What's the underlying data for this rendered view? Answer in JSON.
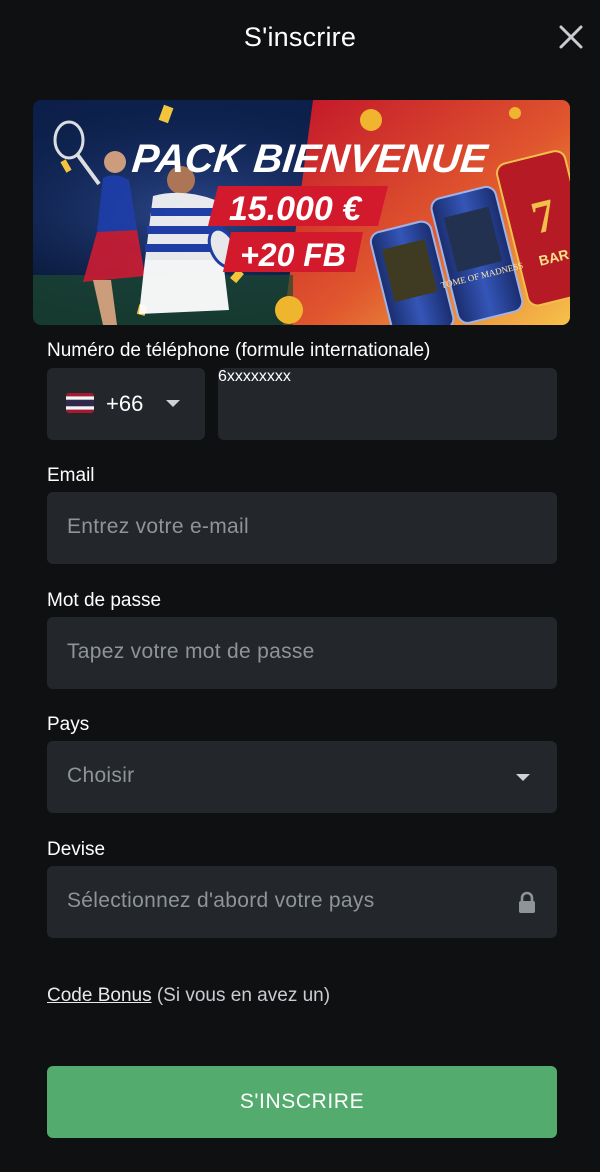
{
  "header": {
    "title": "S'inscrire"
  },
  "banner": {
    "headline": "PACK BIENVENUE",
    "amount": "15.000 €",
    "freebets": "+20 FB",
    "game_title": "TOME OF MADNESS",
    "reel_symbol": "BAR"
  },
  "form": {
    "phone": {
      "label": "Numéro de téléphone (formule internationale)",
      "country_code": "+66",
      "placeholder": "6xxxxxxxx"
    },
    "email": {
      "label": "Email",
      "placeholder": "Entrez votre e-mail"
    },
    "password": {
      "label": "Mot de passe",
      "placeholder": "Tapez votre mot de passe"
    },
    "country": {
      "label": "Pays",
      "placeholder": "Choisir"
    },
    "currency": {
      "label": "Devise",
      "placeholder": "Sélectionnez d'abord votre pays"
    },
    "bonus": {
      "link_text": "Code Bonus",
      "hint": " (Si vous en avez un)"
    },
    "submit_label": "S'INSCRIRE"
  },
  "colors": {
    "background": "#0f1012",
    "field": "#23262a",
    "accent": "#53ac6e",
    "placeholder": "#8f9499"
  }
}
